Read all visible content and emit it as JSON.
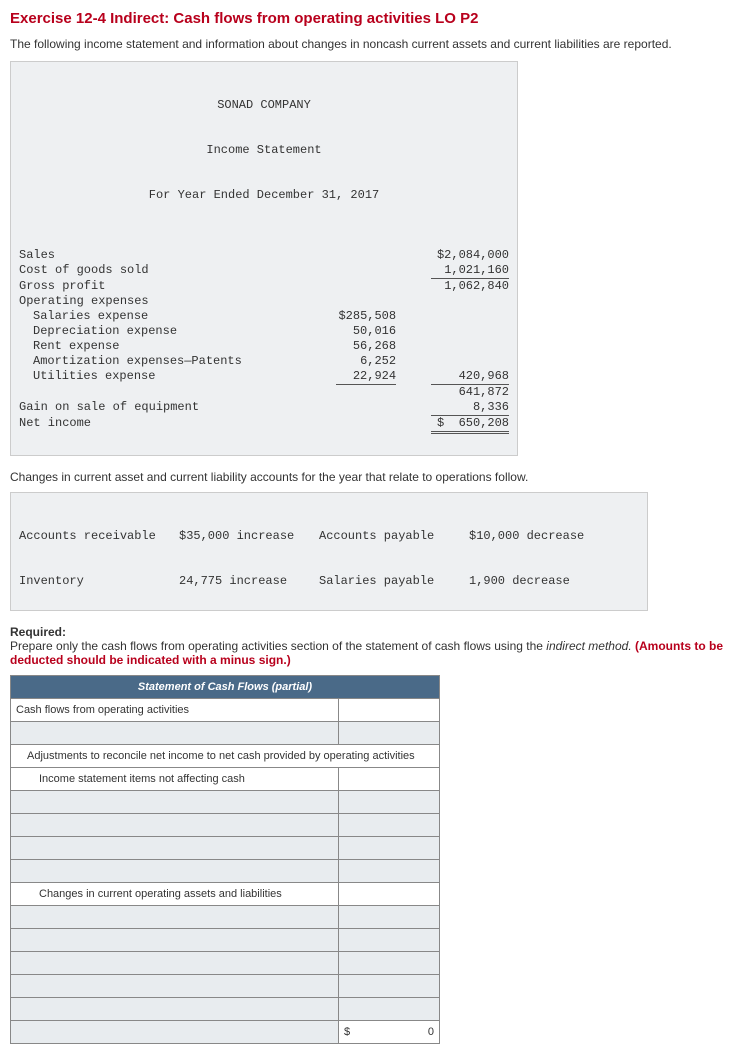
{
  "title": "Exercise 12-4 Indirect: Cash flows from operating activities LO P2",
  "intro": "The following income statement and information about changes in noncash current assets and current liabilities are reported.",
  "income": {
    "company": "SONAD COMPANY",
    "statement": "Income Statement",
    "period": "For Year Ended December 31, 2017",
    "sales_label": "Sales",
    "sales": "$2,084,000",
    "cogs_label": "Cost of goods sold",
    "cogs": "1,021,160",
    "gross_label": "Gross profit",
    "gross": "1,062,840",
    "opex_label": "Operating expenses",
    "salaries_label": "Salaries expense",
    "salaries": "$285,508",
    "dep_label": "Depreciation expense",
    "dep": "50,016",
    "rent_label": "Rent expense",
    "rent": "56,268",
    "amort_label": "Amortization expenses—Patents",
    "amort": "6,252",
    "util_label": "Utilities expense",
    "util": "22,924",
    "opex_total": "420,968",
    "op_inc": "641,872",
    "gain_label": "Gain on sale of equipment",
    "gain": "8,336",
    "ni_label": "Net income",
    "ni": "$  650,208"
  },
  "changes_text": "Changes in current asset and current liability accounts for the year that relate to operations follow.",
  "changes": {
    "ar_label": "Accounts receivable",
    "ar_val": "$35,000 increase",
    "inv_label": "Inventory",
    "inv_val": "24,775 increase",
    "ap_label": "Accounts payable",
    "ap_val": "$10,000 decrease",
    "sp_label": "Salaries payable",
    "sp_val": "1,900 decrease"
  },
  "required": {
    "label": "Required:",
    "text_a": "Prepare only the cash flows from operating activities section of the statement of cash flows using the ",
    "italic": "indirect method. ",
    "red": "(Amounts to be deducted should be indicated with a minus sign.)"
  },
  "worksheet": {
    "header": "Statement of Cash Flows (partial)",
    "cfo_label": "Cash flows from operating activities",
    "adj_label": "Adjustments to reconcile net income to net cash provided by operating activities",
    "income_items_label": "Income statement items not affecting cash",
    "changes_label": "Changes in current operating assets and liabilities",
    "total_sym": "$",
    "total_val": "0"
  }
}
